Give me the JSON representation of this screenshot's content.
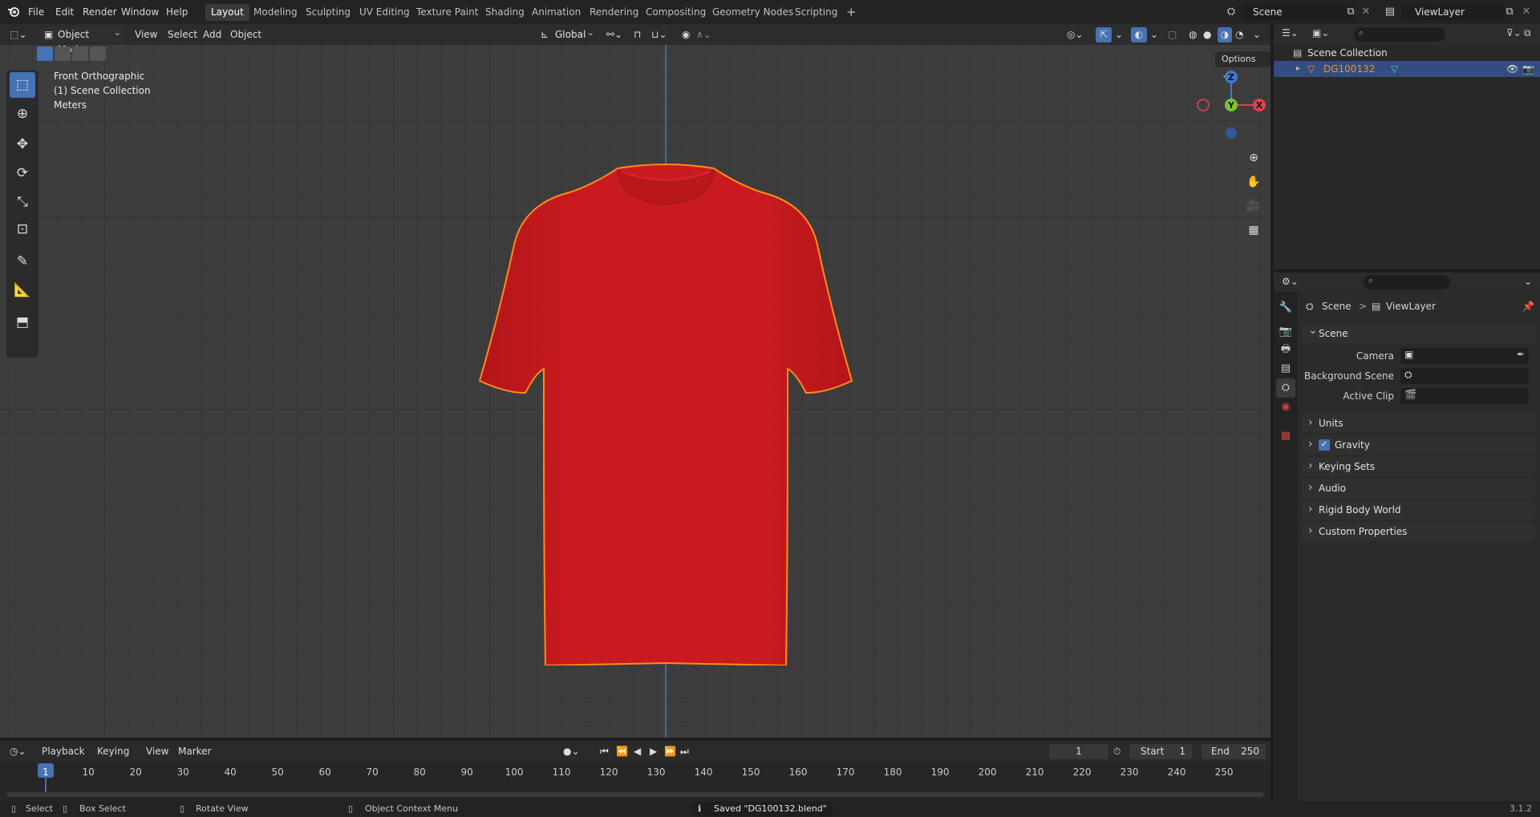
{
  "app": {
    "version": "3.1.2"
  },
  "menu": {
    "items": [
      "File",
      "Edit",
      "Render",
      "Window",
      "Help"
    ]
  },
  "workspaces": {
    "tabs": [
      "Layout",
      "Modeling",
      "Sculpting",
      "UV Editing",
      "Texture Paint",
      "Shading",
      "Animation",
      "Rendering",
      "Compositing",
      "Geometry Nodes",
      "Scripting"
    ],
    "active": "Layout",
    "add_symbol": "+"
  },
  "scene_field": {
    "value": "Scene"
  },
  "viewlayer_field": {
    "value": "ViewLayer"
  },
  "viewport": {
    "mode": "Object Mode",
    "menus": [
      "View",
      "Select",
      "Add",
      "Object"
    ],
    "orientation": "Global",
    "overlay_lines": [
      "Front Orthographic",
      "(1) Scene Collection",
      "Meters"
    ],
    "options_label": "Options",
    "gizmo": {
      "x": "X",
      "y": "Y",
      "z": "Z"
    },
    "object_color": "#c81a1f",
    "selection_outline_color": "#ff8a1a"
  },
  "outliner": {
    "root": "Scene Collection",
    "items": [
      {
        "label": "DG100132",
        "selected": true
      }
    ]
  },
  "properties": {
    "breadcrumb": {
      "scene": "Scene",
      "separator": ">",
      "viewlayer": "ViewLayer"
    },
    "scene_panel": {
      "title": "Scene",
      "fields": [
        {
          "label": "Camera"
        },
        {
          "label": "Background Scene"
        },
        {
          "label": "Active Clip"
        }
      ]
    },
    "panels": [
      "Units",
      "Gravity",
      "Keying Sets",
      "Audio",
      "Rigid Body World",
      "Custom Properties"
    ],
    "gravity_checked": true
  },
  "timeline": {
    "menus": [
      "Playback",
      "Keying",
      "View",
      "Marker"
    ],
    "current_frame": "1",
    "start_label": "Start",
    "start_value": "1",
    "end_label": "End",
    "end_value": "250",
    "ruler": [
      "1",
      "10",
      "20",
      "30",
      "40",
      "50",
      "60",
      "70",
      "80",
      "90",
      "100",
      "110",
      "120",
      "130",
      "140",
      "150",
      "160",
      "170",
      "180",
      "190",
      "200",
      "210",
      "220",
      "230",
      "240",
      "250"
    ]
  },
  "statusbar": {
    "select": "Select",
    "box_select": "Box Select",
    "rotate_view": "Rotate View",
    "context_menu": "Object Context Menu",
    "saved_message": "Saved \"DG100132.blend\""
  }
}
